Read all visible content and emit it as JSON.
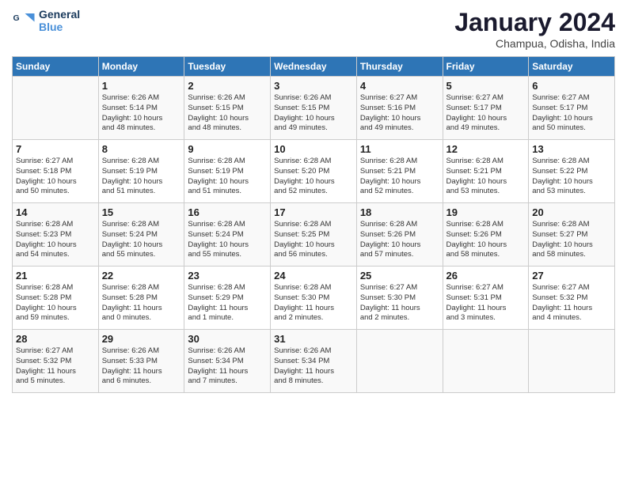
{
  "logo": {
    "line1": "General",
    "line2": "Blue"
  },
  "title": "January 2024",
  "subtitle": "Champua, Odisha, India",
  "days_of_week": [
    "Sunday",
    "Monday",
    "Tuesday",
    "Wednesday",
    "Thursday",
    "Friday",
    "Saturday"
  ],
  "weeks": [
    [
      {
        "day": "",
        "info": ""
      },
      {
        "day": "1",
        "info": "Sunrise: 6:26 AM\nSunset: 5:14 PM\nDaylight: 10 hours\nand 48 minutes."
      },
      {
        "day": "2",
        "info": "Sunrise: 6:26 AM\nSunset: 5:15 PM\nDaylight: 10 hours\nand 48 minutes."
      },
      {
        "day": "3",
        "info": "Sunrise: 6:26 AM\nSunset: 5:15 PM\nDaylight: 10 hours\nand 49 minutes."
      },
      {
        "day": "4",
        "info": "Sunrise: 6:27 AM\nSunset: 5:16 PM\nDaylight: 10 hours\nand 49 minutes."
      },
      {
        "day": "5",
        "info": "Sunrise: 6:27 AM\nSunset: 5:17 PM\nDaylight: 10 hours\nand 49 minutes."
      },
      {
        "day": "6",
        "info": "Sunrise: 6:27 AM\nSunset: 5:17 PM\nDaylight: 10 hours\nand 50 minutes."
      }
    ],
    [
      {
        "day": "7",
        "info": "Sunrise: 6:27 AM\nSunset: 5:18 PM\nDaylight: 10 hours\nand 50 minutes."
      },
      {
        "day": "8",
        "info": "Sunrise: 6:28 AM\nSunset: 5:19 PM\nDaylight: 10 hours\nand 51 minutes."
      },
      {
        "day": "9",
        "info": "Sunrise: 6:28 AM\nSunset: 5:19 PM\nDaylight: 10 hours\nand 51 minutes."
      },
      {
        "day": "10",
        "info": "Sunrise: 6:28 AM\nSunset: 5:20 PM\nDaylight: 10 hours\nand 52 minutes."
      },
      {
        "day": "11",
        "info": "Sunrise: 6:28 AM\nSunset: 5:21 PM\nDaylight: 10 hours\nand 52 minutes."
      },
      {
        "day": "12",
        "info": "Sunrise: 6:28 AM\nSunset: 5:21 PM\nDaylight: 10 hours\nand 53 minutes."
      },
      {
        "day": "13",
        "info": "Sunrise: 6:28 AM\nSunset: 5:22 PM\nDaylight: 10 hours\nand 53 minutes."
      }
    ],
    [
      {
        "day": "14",
        "info": "Sunrise: 6:28 AM\nSunset: 5:23 PM\nDaylight: 10 hours\nand 54 minutes."
      },
      {
        "day": "15",
        "info": "Sunrise: 6:28 AM\nSunset: 5:24 PM\nDaylight: 10 hours\nand 55 minutes."
      },
      {
        "day": "16",
        "info": "Sunrise: 6:28 AM\nSunset: 5:24 PM\nDaylight: 10 hours\nand 55 minutes."
      },
      {
        "day": "17",
        "info": "Sunrise: 6:28 AM\nSunset: 5:25 PM\nDaylight: 10 hours\nand 56 minutes."
      },
      {
        "day": "18",
        "info": "Sunrise: 6:28 AM\nSunset: 5:26 PM\nDaylight: 10 hours\nand 57 minutes."
      },
      {
        "day": "19",
        "info": "Sunrise: 6:28 AM\nSunset: 5:26 PM\nDaylight: 10 hours\nand 58 minutes."
      },
      {
        "day": "20",
        "info": "Sunrise: 6:28 AM\nSunset: 5:27 PM\nDaylight: 10 hours\nand 58 minutes."
      }
    ],
    [
      {
        "day": "21",
        "info": "Sunrise: 6:28 AM\nSunset: 5:28 PM\nDaylight: 10 hours\nand 59 minutes."
      },
      {
        "day": "22",
        "info": "Sunrise: 6:28 AM\nSunset: 5:28 PM\nDaylight: 11 hours\nand 0 minutes."
      },
      {
        "day": "23",
        "info": "Sunrise: 6:28 AM\nSunset: 5:29 PM\nDaylight: 11 hours\nand 1 minute."
      },
      {
        "day": "24",
        "info": "Sunrise: 6:28 AM\nSunset: 5:30 PM\nDaylight: 11 hours\nand 2 minutes."
      },
      {
        "day": "25",
        "info": "Sunrise: 6:27 AM\nSunset: 5:30 PM\nDaylight: 11 hours\nand 2 minutes."
      },
      {
        "day": "26",
        "info": "Sunrise: 6:27 AM\nSunset: 5:31 PM\nDaylight: 11 hours\nand 3 minutes."
      },
      {
        "day": "27",
        "info": "Sunrise: 6:27 AM\nSunset: 5:32 PM\nDaylight: 11 hours\nand 4 minutes."
      }
    ],
    [
      {
        "day": "28",
        "info": "Sunrise: 6:27 AM\nSunset: 5:32 PM\nDaylight: 11 hours\nand 5 minutes."
      },
      {
        "day": "29",
        "info": "Sunrise: 6:26 AM\nSunset: 5:33 PM\nDaylight: 11 hours\nand 6 minutes."
      },
      {
        "day": "30",
        "info": "Sunrise: 6:26 AM\nSunset: 5:34 PM\nDaylight: 11 hours\nand 7 minutes."
      },
      {
        "day": "31",
        "info": "Sunrise: 6:26 AM\nSunset: 5:34 PM\nDaylight: 11 hours\nand 8 minutes."
      },
      {
        "day": "",
        "info": ""
      },
      {
        "day": "",
        "info": ""
      },
      {
        "day": "",
        "info": ""
      }
    ]
  ]
}
